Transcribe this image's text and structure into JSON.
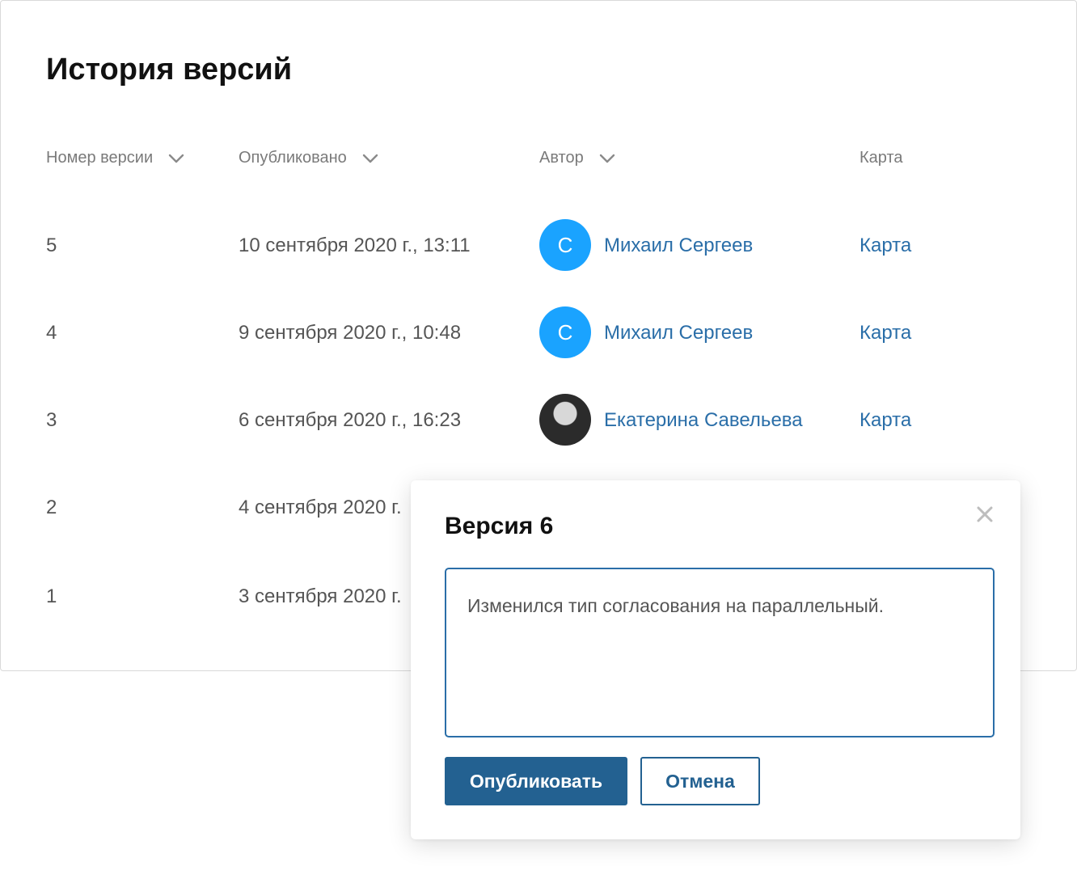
{
  "page": {
    "title": "История версий"
  },
  "table": {
    "columns": {
      "version": "Номер версии",
      "published": "Опубликовано",
      "author": "Автор",
      "map": "Карта"
    },
    "rows": [
      {
        "version": "5",
        "published": "10 сентября 2020 г., 13:11",
        "author_initial": "С",
        "author": "Михаил Сергеев",
        "map": "Карта"
      },
      {
        "version": "4",
        "published": "9 сентября 2020 г., 10:48",
        "author_initial": "С",
        "author": "Михаил Сергеев",
        "map": "Карта"
      },
      {
        "version": "3",
        "published": "6 сентября 2020 г., 16:23",
        "author_initial": "",
        "author": "Екатерина Савельева",
        "map": "Карта"
      },
      {
        "version": "2",
        "published": "4 сентября 2020 г."
      },
      {
        "version": "1",
        "published": "3 сентября 2020 г."
      }
    ]
  },
  "dialog": {
    "title": "Версия 6",
    "comment": "Изменился тип согласования на параллельный.",
    "publish_label": "Опубликовать",
    "cancel_label": "Отмена"
  },
  "colors": {
    "accent": "#236191",
    "link": "#2a6ea8",
    "avatar": "#1aa3ff"
  },
  "icons": [
    "chevron-down-icon",
    "close-icon"
  ]
}
